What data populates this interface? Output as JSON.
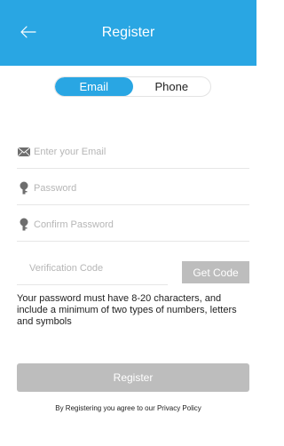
{
  "header": {
    "title": "Register",
    "back_icon": "back-arrow-icon",
    "bg_color": "#29a6e3"
  },
  "segment": {
    "email_label": "Email",
    "phone_label": "Phone",
    "selected": "Email"
  },
  "form": {
    "email_placeholder": "Enter your Email",
    "email_icon": "envelope-icon",
    "password_placeholder": "Password",
    "password_icon": "key-icon",
    "confirm_placeholder": "Confirm Password",
    "confirm_icon": "key-icon",
    "verification_placeholder": "Verification Code",
    "get_code_label": "Get Code"
  },
  "hint": "Your password must have 8-20 characters, and include a minimum of two types of numbers, letters and symbols",
  "register_label": "Register",
  "agreement": "By Registering you agree to our Privacy Policy"
}
